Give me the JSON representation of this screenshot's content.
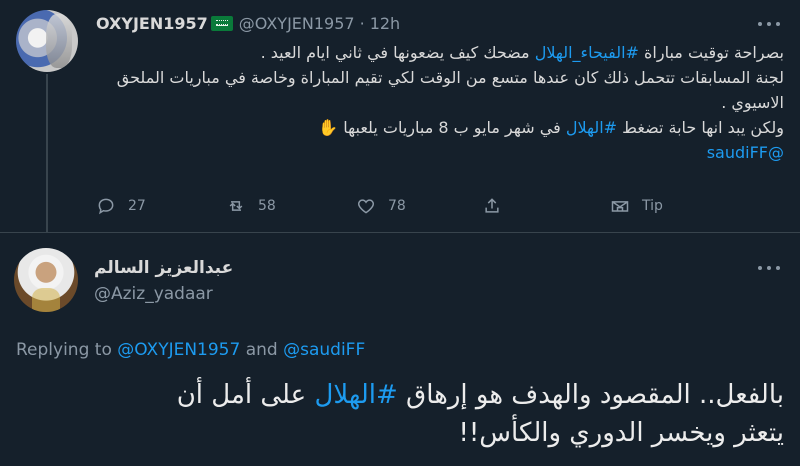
{
  "tweet1": {
    "display_name": "OXYJEN1957",
    "handle": "@OXYJEN1957",
    "separator": "·",
    "time": "12h",
    "lines": [
      {
        "before": "بصراحة توقيت مباراة ",
        "tag": "#الفيحاء_الهلال",
        "after": " مضحك كيف يضعونها في ثاني ايام العيد ."
      },
      {
        "before": "لجنة المسابقات تتحمل ذلك كان عندها متسع من الوقت لكي تقيم المباراة وخاصة في مباريات الملحق الاسيوي .",
        "tag": "",
        "after": ""
      },
      {
        "before": "ولكن يبد انها حابة تضغط ",
        "tag": "#الهلال",
        "after": " في شهر مايو ب 8 مباريات يلعبها ✋"
      },
      {
        "before": "",
        "tag": "@saudiFF",
        "after": ""
      }
    ],
    "actions": {
      "reply_count": "27",
      "retweet_count": "58",
      "like_count": "78",
      "tip_label": "Tip"
    }
  },
  "tweet2": {
    "display_name": "عبدالعزيز السالم",
    "handle": "@Aziz_yadaar",
    "replying": {
      "prefix": "Replying to ",
      "mention1": "@OXYJEN1957",
      "and": " and ",
      "mention2": "@saudiFF"
    },
    "line1_before": "بالفعل.. المقصود والهدف هو إرهاق ",
    "line1_tag": "#الهلال",
    "line1_after": " على أمل أن",
    "line2": "يتعثر ويخسر الدوري والكأس!!"
  },
  "colors": {
    "background": "#15202b",
    "link": "#1d9bf0",
    "muted": "#8b98a5",
    "divider": "#38444d"
  }
}
